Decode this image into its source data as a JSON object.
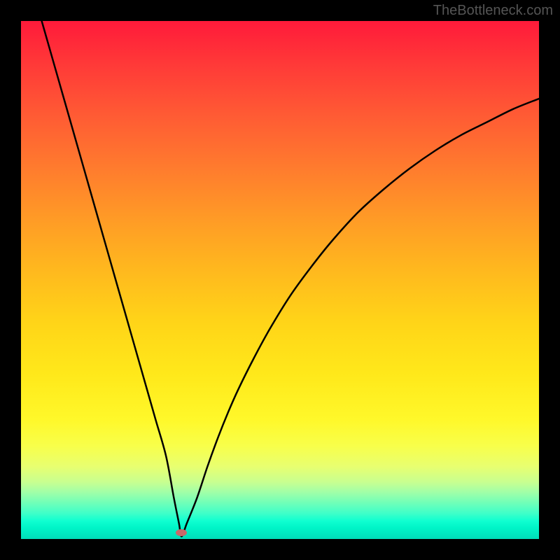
{
  "attribution": "TheBottleneck.com",
  "chart_data": {
    "type": "line",
    "title": "",
    "xlabel": "",
    "ylabel": "",
    "xlim": [
      0,
      100
    ],
    "ylim": [
      0,
      100
    ],
    "legend": false,
    "grid": false,
    "series": [
      {
        "name": "bottleneck-curve",
        "x": [
          4,
          6,
          8,
          10,
          12,
          14,
          16,
          18,
          20,
          22,
          24,
          26,
          28,
          29.5,
          30.5,
          31,
          32,
          34,
          36,
          38,
          40,
          42,
          45,
          48,
          52,
          56,
          60,
          65,
          70,
          75,
          80,
          85,
          90,
          95,
          100
        ],
        "y": [
          100,
          93,
          86,
          79,
          72,
          65,
          58,
          51,
          44,
          37,
          30,
          23,
          16,
          8,
          3,
          0.5,
          3,
          8,
          14,
          19.5,
          24.5,
          29,
          35,
          40.5,
          47,
          52.5,
          57.5,
          63,
          67.5,
          71.5,
          75,
          78,
          80.5,
          83,
          85
        ]
      }
    ],
    "annotations": [
      {
        "name": "optimal-marker",
        "x": 31,
        "y": 1.2
      }
    ],
    "gradient": {
      "top_color": "#ff1a3a",
      "mid_color": "#ffe81a",
      "bottom_color": "#00dcb8"
    }
  }
}
